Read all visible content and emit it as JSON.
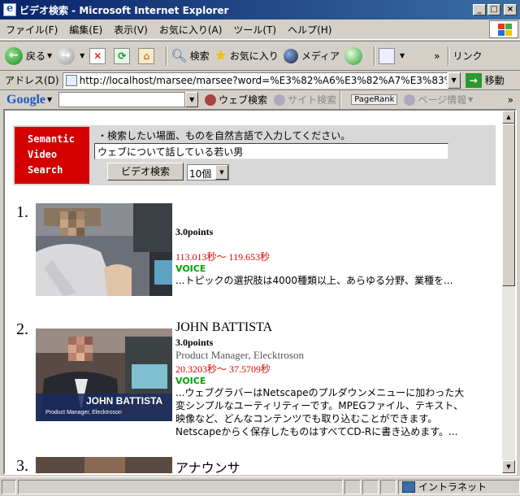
{
  "window": {
    "title": "ビデオ検索 - Microsoft Internet Explorer",
    "minimize": "_",
    "maximize": "□",
    "close": "×"
  },
  "menu": [
    "ファイル(F)",
    "編集(E)",
    "表示(V)",
    "お気に入り(A)",
    "ツール(T)",
    "ヘルプ(H)"
  ],
  "toolbar": {
    "back": "戻る",
    "search": "検索",
    "favorites": "お気に入り",
    "media": "メディア",
    "more": "»",
    "links": "リンク"
  },
  "address": {
    "label": "アドレス(D)",
    "url": "http://localhost/marsee/marsee?word=%E3%82%A6%E3%82%A7%E3%83%96%E3%81%AB%E",
    "go": "移動"
  },
  "google": {
    "logo": "Google",
    "web_search": "ウェブ検索",
    "site_search": "サイト検索",
    "pagerank": "PageRank",
    "page_info": "ページ情報",
    "more": "»"
  },
  "search_panel": {
    "logo_lines": [
      "Semantic",
      "Video",
      "Search"
    ],
    "instruction": "・検索したい場面、ものを自然言語で入力してください。",
    "query": "ウェブについて話している若い男",
    "button": "ビデオ検索",
    "count": "10個"
  },
  "results": [
    {
      "number": "1.",
      "title": "",
      "points": "3.0points",
      "subtitle": "",
      "time": "113.013秒〜 119.653秒",
      "type": "VOICE",
      "snippet": "...トピックの選択肢は4000種類以上、あらゆる分野、業種を..."
    },
    {
      "number": "2.",
      "title": "JOHN BATTISTA",
      "points": "3.0points",
      "subtitle": "Product Manager, Elecktroson",
      "time": "20.3203秒〜 37.5709秒",
      "type": "VOICE",
      "snippet": "...ウェブグラバーはNetscapeのプルダウンメニューに加わった大変シンプルなユーティリティーです。MPEGファイル、テキスト、映像など、どんなコンテンツでも取り込むことができます。Netscapeからく保存したものはすべてCD-Rに書き込めます。...",
      "caption_name": "JOHN BATTISTA",
      "caption_role": "Product Manager, Elecktroson"
    },
    {
      "number": "3.",
      "title": "アナウンサ"
    }
  ],
  "status": {
    "zone": "イントラネット"
  }
}
